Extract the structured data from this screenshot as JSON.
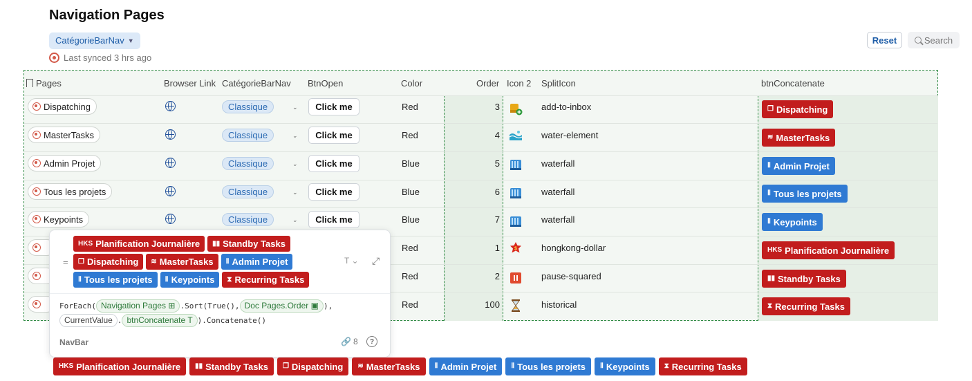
{
  "page": {
    "title": "Navigation Pages",
    "category_filter": "CatégorieBarNav",
    "sync_text": "Last synced 3 hrs ago",
    "reset_label": "Reset",
    "search_label": "Search"
  },
  "table": {
    "headers": {
      "pages": "Pages",
      "browser_link": "Browser Link",
      "categorie": "CatégorieBarNav",
      "btn_open": "BtnOpen",
      "color": "Color",
      "order": "Order",
      "icon2": "Icon 2",
      "split_icon": "SplitIcon",
      "btn_concat": "btnConcatenate"
    },
    "rows": [
      {
        "page": "Dispatching",
        "categorie": "Classique",
        "btn": "Click me",
        "color": "Red",
        "order": "3",
        "icon": "package-add",
        "split_icon": "add-to-inbox",
        "concat": "Dispatching",
        "concat_color": "red",
        "concat_glyph": "❐"
      },
      {
        "page": "MasterTasks",
        "categorie": "Classique",
        "btn": "Click me",
        "color": "Red",
        "order": "4",
        "icon": "water-wave",
        "split_icon": "water-element",
        "concat": "MasterTasks",
        "concat_color": "red",
        "concat_glyph": "≋"
      },
      {
        "page": "Admin Projet",
        "categorie": "Classique",
        "btn": "Click me",
        "color": "Blue",
        "order": "5",
        "icon": "waterfall",
        "split_icon": "waterfall",
        "concat": "Admin Projet",
        "concat_color": "blue",
        "concat_glyph": "Ⅱ"
      },
      {
        "page": "Tous les projets",
        "categorie": "Classique",
        "btn": "Click me",
        "color": "Blue",
        "order": "6",
        "icon": "waterfall",
        "split_icon": "waterfall",
        "concat": "Tous les projets",
        "concat_color": "blue",
        "concat_glyph": "Ⅱ"
      },
      {
        "page": "Keypoints",
        "categorie": "Classique",
        "btn": "Click me",
        "color": "Blue",
        "order": "7",
        "icon": "waterfall",
        "split_icon": "waterfall",
        "concat": "Keypoints",
        "concat_color": "blue",
        "concat_glyph": "Ⅱ"
      },
      {
        "page": "Planification Journalière",
        "color": "Red",
        "order": "1",
        "icon": "hongkong-dollar",
        "split_icon": "hongkong-dollar",
        "concat": "Planification Journalière",
        "concat_color": "red",
        "concat_glyph": "HKS"
      },
      {
        "page": "Standby Tasks",
        "color": "Red",
        "order": "2",
        "icon": "pause-squared",
        "split_icon": "pause-squared",
        "concat": "Standby Tasks",
        "concat_color": "red",
        "concat_glyph": "▮▮"
      },
      {
        "page": "Recurring Tasks",
        "color": "Red",
        "order": "100",
        "icon": "hourglass",
        "split_icon": "historical",
        "concat": "Recurring Tasks",
        "concat_color": "red",
        "concat_glyph": "⧗"
      }
    ]
  },
  "popup": {
    "equals": "=",
    "type_label": "T",
    "formula_prefix": "ForEach(",
    "chip_navigation_pages": "Navigation Pages",
    "sort_text": ".Sort(True(),",
    "chip_doc_pages_order": "Doc Pages.Order",
    "close_paren": "),",
    "chip_current_value": "CurrentValue",
    "dot": ".",
    "chip_btn_concat": "btnConcatenate",
    "formula_suffix": ").Concatenate()",
    "name": "NavBar",
    "link_count": "8",
    "help": "?"
  },
  "tags": [
    {
      "label": "Planification Journalière",
      "color": "red",
      "glyph": "HKS"
    },
    {
      "label": "Standby Tasks",
      "color": "red",
      "glyph": "▮▮"
    },
    {
      "label": "Dispatching",
      "color": "red",
      "glyph": "❐"
    },
    {
      "label": "MasterTasks",
      "color": "red",
      "glyph": "≋"
    },
    {
      "label": "Admin Projet",
      "color": "blue",
      "glyph": "Ⅱ"
    },
    {
      "label": "Tous les projets",
      "color": "blue",
      "glyph": "Ⅱ"
    },
    {
      "label": "Keypoints",
      "color": "blue",
      "glyph": "Ⅱ"
    },
    {
      "label": "Recurring Tasks",
      "color": "red",
      "glyph": "⧗"
    }
  ],
  "colors": {
    "red": "#c21d1d",
    "blue": "#2f7ad3",
    "accent_green": "#2f8a43"
  }
}
